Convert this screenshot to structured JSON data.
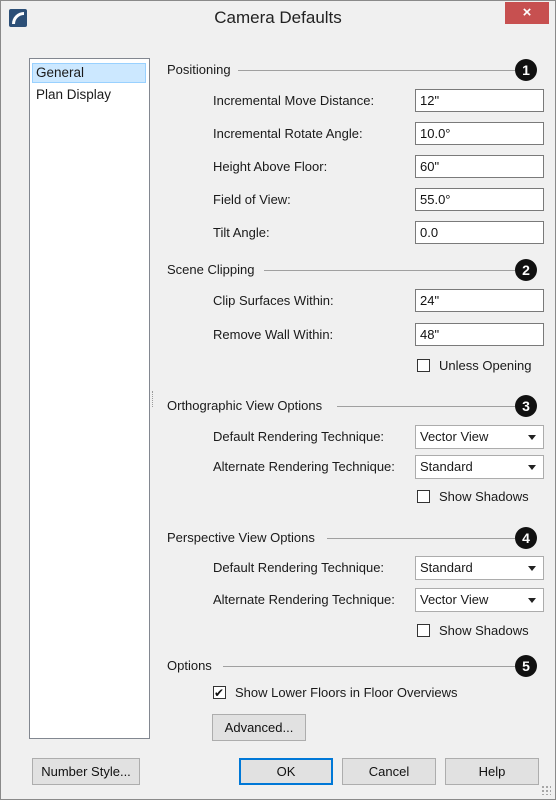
{
  "window": {
    "title": "Camera Defaults",
    "close_glyph": "×",
    "accent": "#c75050"
  },
  "nav": {
    "items": [
      {
        "label": "General",
        "selected": true
      },
      {
        "label": "Plan Display",
        "selected": false
      }
    ]
  },
  "positioning": {
    "heading": "Positioning",
    "badge": "1",
    "fields": [
      {
        "label": "Incremental Move Distance:",
        "value": "12\""
      },
      {
        "label": "Incremental Rotate Angle:",
        "value": "10.0°"
      },
      {
        "label": "Height Above Floor:",
        "value": "60\""
      },
      {
        "label": "Field of View:",
        "value": "55.0°"
      },
      {
        "label": "Tilt Angle:",
        "value": "0.0"
      }
    ]
  },
  "clipping": {
    "heading": "Scene Clipping",
    "badge": "2",
    "fields": [
      {
        "label": "Clip Surfaces Within:",
        "value": "24\""
      },
      {
        "label": "Remove Wall Within:",
        "value": "48\""
      }
    ],
    "unless_opening": {
      "label": "Unless Opening",
      "checked": false
    }
  },
  "ortho": {
    "heading": "Orthographic View Options",
    "badge": "3",
    "default_label": "Default Rendering Technique:",
    "default_value": "Vector View",
    "alternate_label": "Alternate Rendering Technique:",
    "alternate_value": "Standard",
    "shadows": {
      "label": "Show Shadows",
      "checked": false
    }
  },
  "perspective": {
    "heading": "Perspective View Options",
    "badge": "4",
    "default_label": "Default Rendering Technique:",
    "default_value": "Standard",
    "alternate_label": "Alternate Rendering Technique:",
    "alternate_value": "Vector View",
    "shadows": {
      "label": "Show Shadows",
      "checked": false
    }
  },
  "options": {
    "heading": "Options",
    "badge": "5",
    "lower_floors": {
      "label": "Show Lower Floors in Floor Overviews",
      "checked": true
    },
    "advanced_label": "Advanced..."
  },
  "footer": {
    "number_style": "Number Style...",
    "ok": "OK",
    "cancel": "Cancel",
    "help": "Help"
  }
}
